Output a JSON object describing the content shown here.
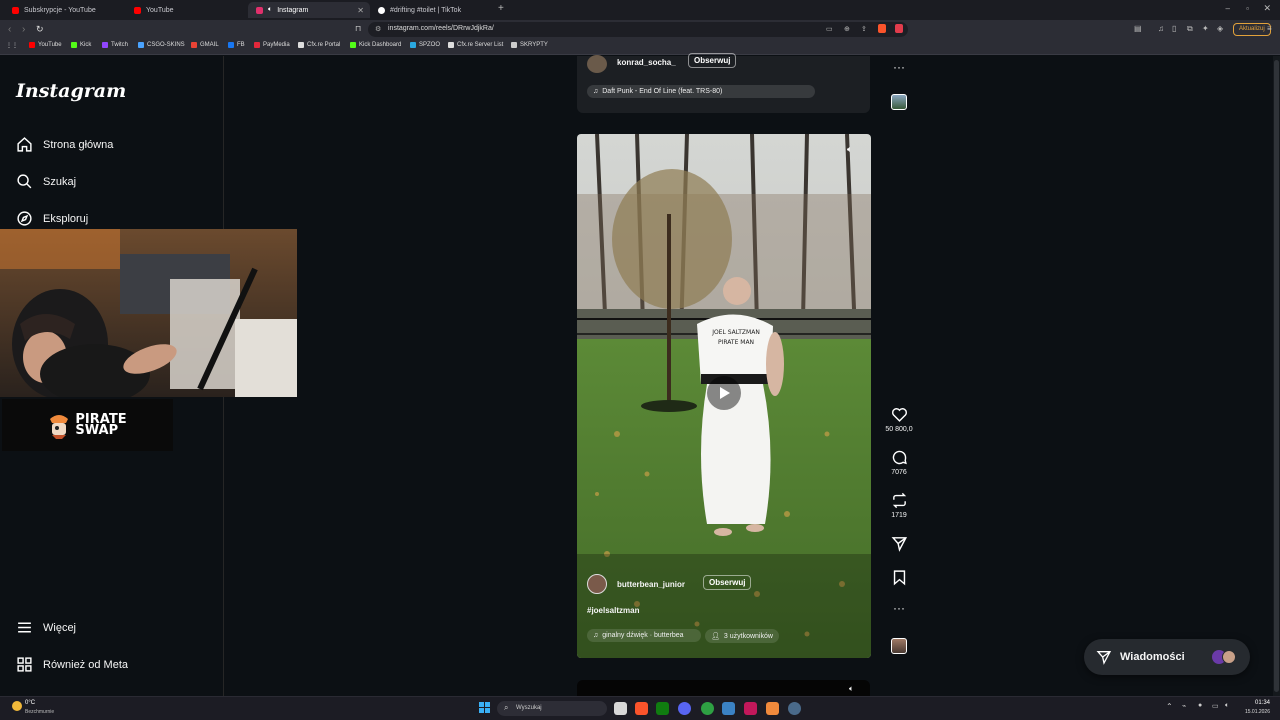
{
  "browser": {
    "tabs": [
      {
        "label": "Subskrypcje - YouTube",
        "color": "#ff0000"
      },
      {
        "label": "YouTube",
        "color": "#ff0000"
      },
      {
        "label": "Instagram",
        "color": "#e1306c",
        "active": true
      },
      {
        "label": "#drifting #toilet | TikTok",
        "color": "#ffffff"
      }
    ],
    "new_tab": "+",
    "url": "instagram.com/reels/DRrwJdjkRa/",
    "update_label": "Aktualizuj",
    "bookmarks": [
      {
        "label": "YouTube",
        "color": "#ff0000"
      },
      {
        "label": "Kick",
        "color": "#53fc18"
      },
      {
        "label": "Twitch",
        "color": "#9146ff"
      },
      {
        "label": "CSGO-SKINS",
        "color": "#4aa3ff"
      },
      {
        "label": "GMAIL",
        "color": "#ea4335"
      },
      {
        "label": "FB",
        "color": "#1877f2"
      },
      {
        "label": "PayMedia",
        "color": "#e2283b"
      },
      {
        "label": "Cfx.re Portal",
        "color": "#dddddd"
      },
      {
        "label": "Kick Dashboard",
        "color": "#53fc18"
      },
      {
        "label": "SPZOO",
        "color": "#2aa8e0"
      },
      {
        "label": "Cfx.re Server List",
        "color": "#dddddd"
      },
      {
        "label": "SKRYPTY",
        "color": "#cccccc"
      }
    ]
  },
  "sidebar": {
    "logo": "Instagram",
    "items": [
      {
        "label": "Strona główna",
        "icon": "home-icon"
      },
      {
        "label": "Szukaj",
        "icon": "search-icon"
      },
      {
        "label": "Eksploruj",
        "icon": "compass-icon"
      }
    ],
    "bottom_items": [
      {
        "label": "Więcej",
        "icon": "menu-icon"
      },
      {
        "label": "Również od Meta",
        "icon": "meta-grid-icon"
      }
    ],
    "sponsor": {
      "line1": "PIRATE",
      "line2": "SWAP"
    }
  },
  "previous_reel": {
    "username": "konrad_socha_",
    "follow_label": "Obserwuj",
    "audio": "Daft Punk - End Of Line (feat. TRS-80)"
  },
  "reel": {
    "username": "butterbean_junior",
    "follow_label": "Obserwuj",
    "hashtag": "#joelsaltzman",
    "audio": "ginalny dźwięk · butterbea",
    "users": "3 użytkowników",
    "shirt_line1": "JOEL SALTZMAN",
    "shirt_line2": "PIRATE MAN"
  },
  "actions": {
    "likes": "50 800,0",
    "comments": "7076",
    "reposts": "1719"
  },
  "messages": {
    "label": "Wiadomości"
  },
  "taskbar": {
    "weather_temp": "0°C",
    "weather_desc": "Bezchmurnie",
    "search_placeholder": "Wyszukaj",
    "time": "01:34",
    "date": "15.01.2026"
  }
}
